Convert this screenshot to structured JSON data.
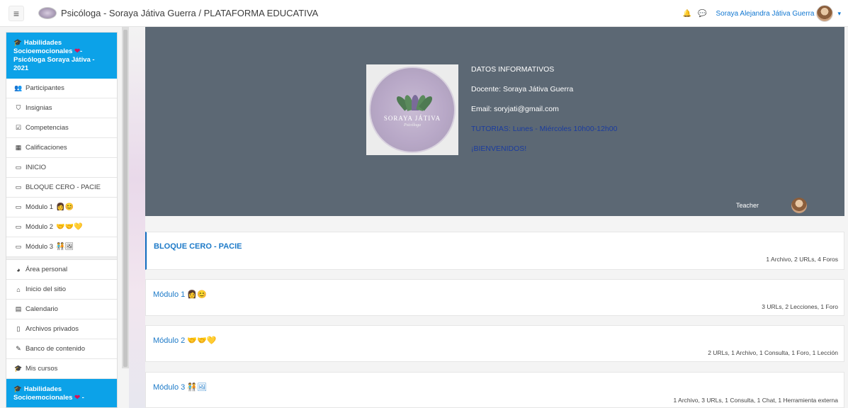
{
  "navbar": {
    "site_title": "Psicóloga - Soraya Játiva Guerra / PLATAFORMA EDUCATIVA",
    "user_name": "Soraya Alejandra Játiva Guerra"
  },
  "sidebar": {
    "course_title": "Habilidades Socioemocionales",
    "course_title2": "- Psicóloga Soraya Játiva - 2021",
    "items": [
      {
        "label": "Participantes",
        "icon": "users-icon"
      },
      {
        "label": "Insignias",
        "icon": "shield-icon"
      },
      {
        "label": "Competencias",
        "icon": "check-square-icon"
      },
      {
        "label": "Calificaciones",
        "icon": "table-icon"
      },
      {
        "label": "INICIO",
        "icon": "folder-icon"
      },
      {
        "label": "BLOQUE CERO - PACIE",
        "icon": "folder-icon"
      },
      {
        "label": "Módulo 1",
        "icon": "folder-icon"
      },
      {
        "label": "Módulo 2",
        "icon": "folder-icon"
      },
      {
        "label": "Módulo 3",
        "icon": "folder-icon"
      }
    ],
    "items2": [
      {
        "label": "Área personal",
        "icon": "dashboard-icon"
      },
      {
        "label": "Inicio del sitio",
        "icon": "home-icon"
      },
      {
        "label": "Calendario",
        "icon": "calendar-icon"
      },
      {
        "label": "Archivos privados",
        "icon": "file-icon"
      },
      {
        "label": "Banco de contenido",
        "icon": "pen-icon"
      },
      {
        "label": "Mis cursos",
        "icon": "graduation-cap-icon"
      }
    ],
    "bottom_course": "Habilidades Socioemocionales",
    "bottom_suffix": "-"
  },
  "banner": {
    "logo_name": "SORAYA JÁTIVA",
    "logo_sub": "Psicóloga",
    "line1": "DATOS INFORMATIVOS",
    "line2": "Docente: Soraya Játiva Guerra",
    "line3": "Email: soryjati@gmail.com",
    "line4": "TUTORIAS: Lunes - Miércoles 10h00-12h00",
    "line5": "¡BIENVENIDOS!",
    "teacher_label": "Teacher"
  },
  "sections": [
    {
      "title": "BLOQUE CERO - PACIE",
      "summary": "1 Archivo, 2 URLs, 4 Foros"
    },
    {
      "title": "Módulo 1",
      "summary": "3 URLs, 2 Lecciones, 1 Foro"
    },
    {
      "title": "Módulo 2",
      "summary": "2 URLs, 1 Archivo, 1 Consulta, 1 Foro, 1 Lección"
    },
    {
      "title": "Módulo 3",
      "summary": "1 Archivo, 3 URLs, 1 Consulta, 1 Chat, 1 Herramienta externa"
    }
  ],
  "colors": {
    "accent": "#0ca2e8",
    "banner_bg": "#5c6874",
    "link": "#1d7ac8"
  }
}
